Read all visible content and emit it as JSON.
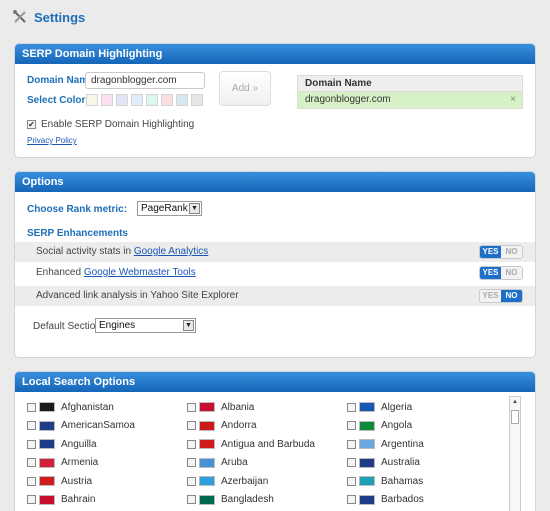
{
  "header": {
    "title": "Settings",
    "icon": "tools-icon"
  },
  "serp": {
    "heading": "SERP Domain Highlighting",
    "domain_label": "Domain Name:",
    "domain_value": "dragonblogger.com",
    "color_label": "Select Color:",
    "swatches": [
      "#f4f8e4",
      "#fbe0ef",
      "#e2e4f8",
      "#dfeefa",
      "#ddf6ee",
      "#fbe0e0",
      "#d8e8f0",
      "#e6e6e6"
    ],
    "add_label": "Add »",
    "enable_label": "Enable SERP Domain Highlighting",
    "enable_checked": "✔",
    "privacy_label": "Privacy Policy",
    "table_header": "Domain Name",
    "table_row": "dragonblogger.com",
    "remove": "×"
  },
  "options": {
    "heading": "Options",
    "rank_label": "Choose Rank metric:",
    "rank_value": "PageRank™",
    "enh_label": "SERP Enhancements",
    "rows": [
      {
        "pre": "Social activity stats in ",
        "link": "Google Analytics",
        "post": "",
        "yes": "YES",
        "no": "NO",
        "state": "yes"
      },
      {
        "pre": "Enhanced ",
        "link": "Google Webmaster Tools",
        "post": "",
        "yes": "YES",
        "no": "NO",
        "state": "yes"
      },
      {
        "pre": "Advanced link analysis in Yahoo Site Explorer",
        "link": "",
        "post": "",
        "yes": "YES",
        "no": "NO",
        "state": "no"
      }
    ],
    "default_label": "Default Section:",
    "default_value": "Engines",
    "arrow": "▼"
  },
  "local": {
    "heading": "Local Search Options",
    "scroll_up": "▲",
    "countries": [
      [
        "Afghanistan",
        "Albania",
        "Algeria"
      ],
      [
        "AmericanSamoa",
        "Andorra",
        "Angola"
      ],
      [
        "Anguilla",
        "Antigua and Barbuda",
        "Argentina"
      ],
      [
        "Armenia",
        "Aruba",
        "Australia"
      ],
      [
        "Austria",
        "Azerbaijan",
        "Bahamas"
      ],
      [
        "Bahrain",
        "Bangladesh",
        "Barbados"
      ]
    ]
  }
}
